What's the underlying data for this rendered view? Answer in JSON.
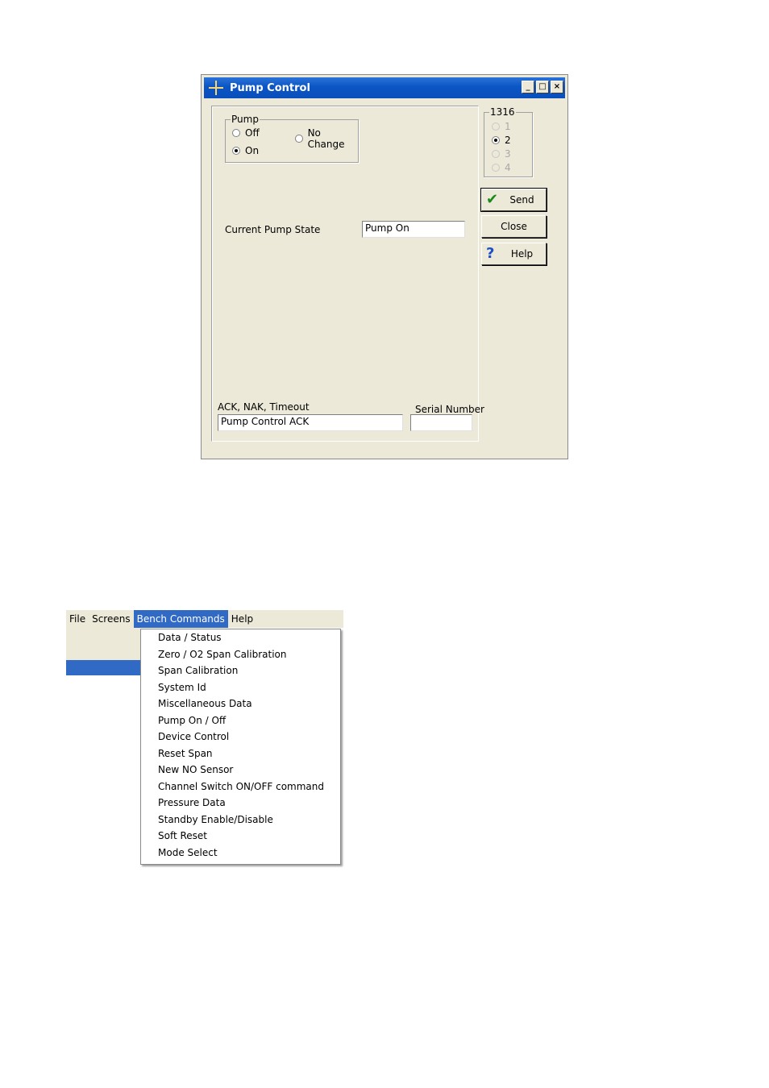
{
  "dialog": {
    "title": "Pump Control",
    "window_buttons": {
      "minimize": "_",
      "maximize": "□",
      "close": "×"
    },
    "pump_group": {
      "legend": "Pump",
      "options": [
        {
          "label": "Off",
          "selected": false
        },
        {
          "label": "No Change",
          "selected": false
        },
        {
          "label": "On",
          "selected": true
        }
      ]
    },
    "unit_group": {
      "legend": "1316",
      "options": [
        {
          "label": "1",
          "selected": false,
          "enabled": false
        },
        {
          "label": "2",
          "selected": true,
          "enabled": true
        },
        {
          "label": "3",
          "selected": false,
          "enabled": false
        },
        {
          "label": "4",
          "selected": false,
          "enabled": false
        }
      ]
    },
    "current_pump_state": {
      "label": "Current Pump State",
      "value": "Pump On"
    },
    "ack": {
      "label": "ACK, NAK, Timeout",
      "value": "Pump Control  ACK"
    },
    "serial": {
      "label": "Serial Number",
      "value": ""
    },
    "buttons": {
      "send": "Send",
      "close": "Close",
      "help": "Help"
    },
    "icons": {
      "send": "checkmark-icon",
      "help": "question-icon",
      "app": "app-icon"
    }
  },
  "menu": {
    "bar": [
      "File",
      "Screens",
      "Bench Commands",
      "Help"
    ],
    "active": "Bench Commands",
    "items": [
      "Data / Status",
      "Zero / O2 Span Calibration",
      "Span Calibration",
      "System Id",
      "Miscellaneous Data",
      "Pump On / Off",
      "Device Control",
      "Reset Span",
      "New NO Sensor",
      "Channel Switch ON/OFF command",
      "Pressure Data",
      "Standby Enable/Disable",
      "Soft Reset",
      "Mode Select"
    ]
  },
  "colors": {
    "title_bar": "#0b55c4",
    "menu_highlight": "#316ac5",
    "dialog_bg": "#ece9d8"
  }
}
